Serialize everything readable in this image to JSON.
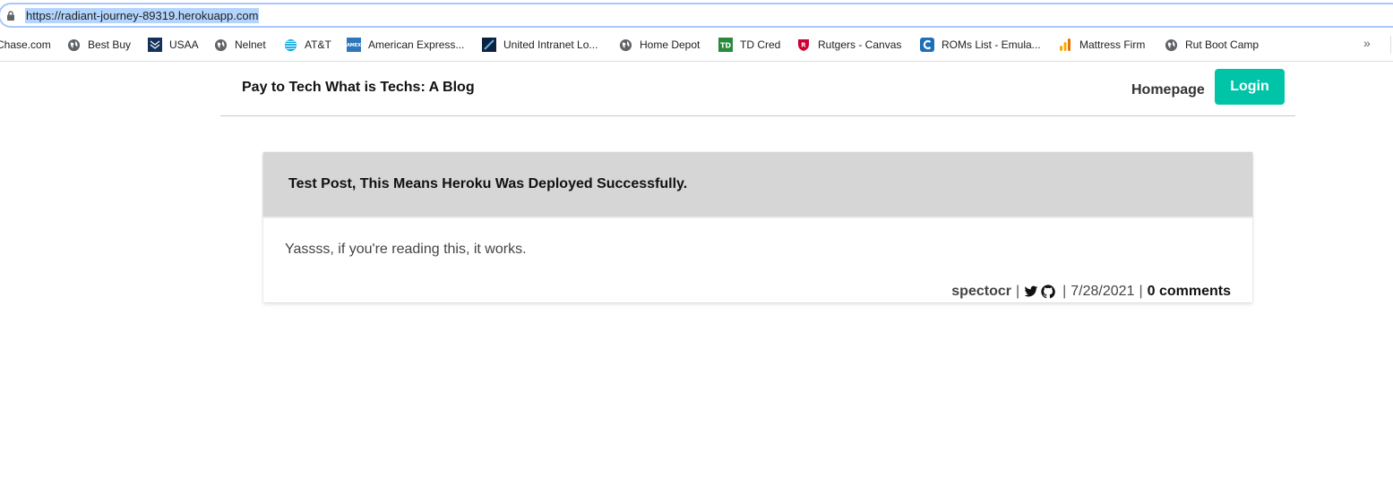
{
  "browser": {
    "url": "https://radiant-journey-89319.herokuapp.com",
    "bookmarks": [
      {
        "label": "Chase.com",
        "icon": "none"
      },
      {
        "label": "Best Buy",
        "icon": "globe-icon"
      },
      {
        "label": "USAA",
        "icon": "usaa-icon"
      },
      {
        "label": "Nelnet",
        "icon": "globe-icon"
      },
      {
        "label": "AT&T",
        "icon": "att-icon"
      },
      {
        "label": "American Express...",
        "icon": "amex-icon"
      },
      {
        "label": "United Intranet Lo...",
        "icon": "united-icon"
      },
      {
        "label": "Home Depot",
        "icon": "globe-icon"
      },
      {
        "label": "TD Cred",
        "icon": "td-icon"
      },
      {
        "label": "Rutgers - Canvas",
        "icon": "rutgers-icon"
      },
      {
        "label": "ROMs List - Emula...",
        "icon": "roms-icon"
      },
      {
        "label": "Mattress Firm",
        "icon": "analytics-icon"
      },
      {
        "label": "Rut Boot Camp",
        "icon": "globe-icon"
      }
    ],
    "more_label": "»"
  },
  "header": {
    "site_title": "Pay to Tech What is Techs: A Blog",
    "nav_home": "Homepage",
    "login": "Login"
  },
  "post": {
    "title": "Test Post, This Means Heroku Was Deployed Successfully.",
    "body": "Yassss, if you're reading this, it works.",
    "author": "spectocr",
    "sep": "|",
    "date": "7/28/2021",
    "comments": "0 comments"
  },
  "colors": {
    "accent": "#00c4a7",
    "post_header_bg": "#d6d6d6",
    "url_highlight": "#b3d4fc"
  }
}
